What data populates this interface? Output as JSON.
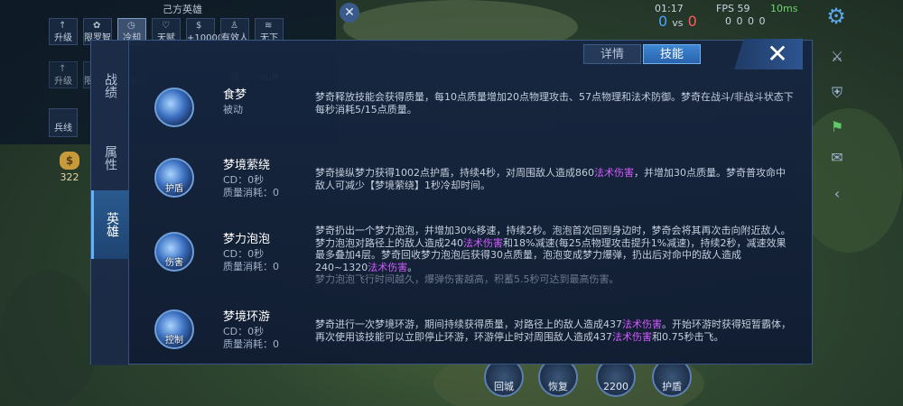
{
  "hud": {
    "panel_title": "己方英雄",
    "tabs": [
      "升级",
      "限罗智胶",
      "冷却",
      "天赋",
      "+10000",
      "有效人偶",
      "无下buff"
    ],
    "row2_tabs": [
      "升级",
      "限罗智胶",
      "AI"
    ],
    "bingxian": "兵线",
    "gold": "322",
    "time": "01:17",
    "fps": "FPS 59",
    "ms": "10ms",
    "score_blue": "0",
    "score_vs": "vs",
    "score_red": "0",
    "kda": "0  0  0  0"
  },
  "bottom_skills": [
    "回城",
    "恢复",
    "2200",
    "护盾"
  ],
  "panel": {
    "side_tabs": [
      "战绩",
      "属性",
      "英雄"
    ],
    "top_tabs": [
      "详情",
      "技能"
    ],
    "close_label": "✕",
    "skills": [
      {
        "name": "食梦",
        "sub1": "被动",
        "sub2": "",
        "badge": "",
        "desc_parts": [
          {
            "t": "梦奇释放技能会获得质量，每10点质量增加20点物理攻击、57点物理和法术防御。梦奇在战斗/非战斗状态下每秒消耗5/15点质量。",
            "hl": false
          }
        ]
      },
      {
        "name": "梦境萦绕",
        "sub1": "CD：0秒",
        "sub2": "质量消耗：0",
        "badge": "护盾",
        "desc_parts": [
          {
            "t": "梦奇操纵梦力获得1002点护盾，持续4秒，对周围敌人造成860",
            "hl": false
          },
          {
            "t": "法术伤害",
            "hl": true
          },
          {
            "t": "，并增加30点质量。梦奇普攻命中敌人可减少【梦境萦绕】1秒冷却时间。",
            "hl": false
          }
        ]
      },
      {
        "name": "梦力泡泡",
        "sub1": "CD：0秒",
        "sub2": "质量消耗：0",
        "badge": "伤害",
        "desc_parts": [
          {
            "t": "梦奇扔出一个梦力泡泡，并增加30%移速，持续2秒。泡泡首次回到身边时，梦奇会将其再次击向附近敌人。梦力泡泡对路径上的敌人造成240",
            "hl": false
          },
          {
            "t": "法术伤害",
            "hl": true
          },
          {
            "t": "和18%减速(每25点物理攻击提升1%减速)，持续2秒，减速效果最多叠加4层。梦奇回收梦力泡泡后获得30点质量，泡泡变成梦力爆弹，扔出后对命中的敌人造成240~1320",
            "hl": false
          },
          {
            "t": "法术伤害",
            "hl": true
          },
          {
            "t": "。",
            "hl": false
          }
        ],
        "desc_faded": "梦力泡泡飞行时间越久，爆弹伤害越高，积蓄5.5秒可达到最高伤害。"
      },
      {
        "name": "梦境环游",
        "sub1": "CD：0秒",
        "sub2": "质量消耗：0",
        "badge": "控制",
        "desc_parts": [
          {
            "t": "梦奇进行一次梦境环游，期间持续获得质量，对路径上的敌人造成437",
            "hl": false
          },
          {
            "t": "法术伤害",
            "hl": true
          },
          {
            "t": "。开始环游时获得短暂霸体，再次使用该技能可以立即停止环游，环游停止时对周围敌人造成437",
            "hl": false
          },
          {
            "t": "法术伤害",
            "hl": true
          },
          {
            "t": "和0.75秒击飞。",
            "hl": false
          }
        ]
      }
    ]
  }
}
